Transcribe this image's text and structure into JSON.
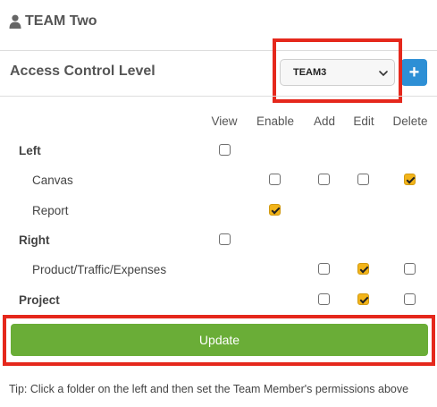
{
  "header": {
    "title": "TEAM Two",
    "icon": "user-icon"
  },
  "access": {
    "label": "Access Control Level",
    "selected_team": "TEAM3",
    "add_label": "+"
  },
  "columns": [
    "View",
    "Enable",
    "Add",
    "Edit",
    "Delete"
  ],
  "rows": [
    {
      "label": "Left",
      "bold": true,
      "view": false
    },
    {
      "label": "Canvas",
      "bold": false,
      "enable": false,
      "add": false,
      "edit": false,
      "delete": true
    },
    {
      "label": "Report",
      "bold": false,
      "enable": true
    },
    {
      "label": "Right",
      "bold": true,
      "view": false
    },
    {
      "label": "Product/Traffic/Expenses",
      "bold": false,
      "add": false,
      "edit": true,
      "delete": false
    },
    {
      "label": "Project",
      "bold": true,
      "add": false,
      "edit": true,
      "delete": false
    }
  ],
  "update_label": "Update",
  "tip": "Tip: Click a folder on the left and then set the Team Member's permissions above",
  "colors": {
    "accent_blue": "#2d8fd5",
    "update_green": "#6aad37",
    "checked_yellow": "#f2b41a",
    "highlight_red": "#e5281c"
  }
}
